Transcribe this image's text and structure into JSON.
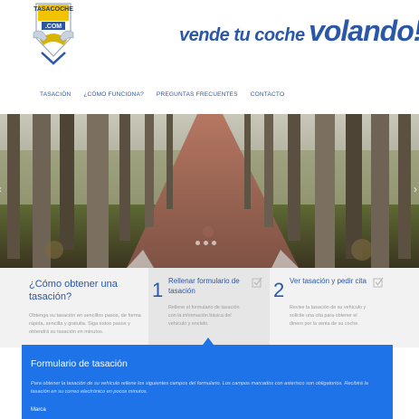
{
  "brand": {
    "logo_line1": "TASACOCHE",
    "logo_line2": ".COM",
    "slogan_part1": "vende tu coche",
    "slogan_part2": "volando!!!",
    "accent": "#2a57a6",
    "logo_icon": "car-shield-logo"
  },
  "nav": {
    "items": [
      {
        "label": "Tasación"
      },
      {
        "label": "¿Cómo funciona?"
      },
      {
        "label": "Preguntas frecuentes"
      },
      {
        "label": "Contacto"
      }
    ]
  },
  "carousel": {
    "prev_icon": "chevron-left-icon",
    "next_icon": "chevron-right-icon",
    "prev_glyph": "‹",
    "next_glyph": "›"
  },
  "how": {
    "title": "¿Cómo obtener una tasación?",
    "text": "Obtenga su tasación en sencillos pasos, de forma rápida, sencilla y gratuita. Siga estos pasos y obtendrá su tasación en minutos."
  },
  "steps": [
    {
      "number": "1",
      "title": "Rellenar formulario de tasación",
      "text": "Rellene el formulario de tasación con la información básica del vehículo y envíelo."
    },
    {
      "number": "2",
      "title": "Ver tasación y pedir cita",
      "text": "Revise la tasación de su vehículo y solicite una cita para obtener el dinero por la venta de su coche."
    }
  ],
  "form": {
    "title": "Formulario de tasación",
    "intro": "Para obtener la tasación de su vehículo rellene los siguientes campos del formulario. Los campos marcados con asterisco son obligatorios. Recibirá la tasación en su correo electrónico en pocos minutos.",
    "first_field_label": "Marca",
    "bg_color": "#1e73e8"
  }
}
